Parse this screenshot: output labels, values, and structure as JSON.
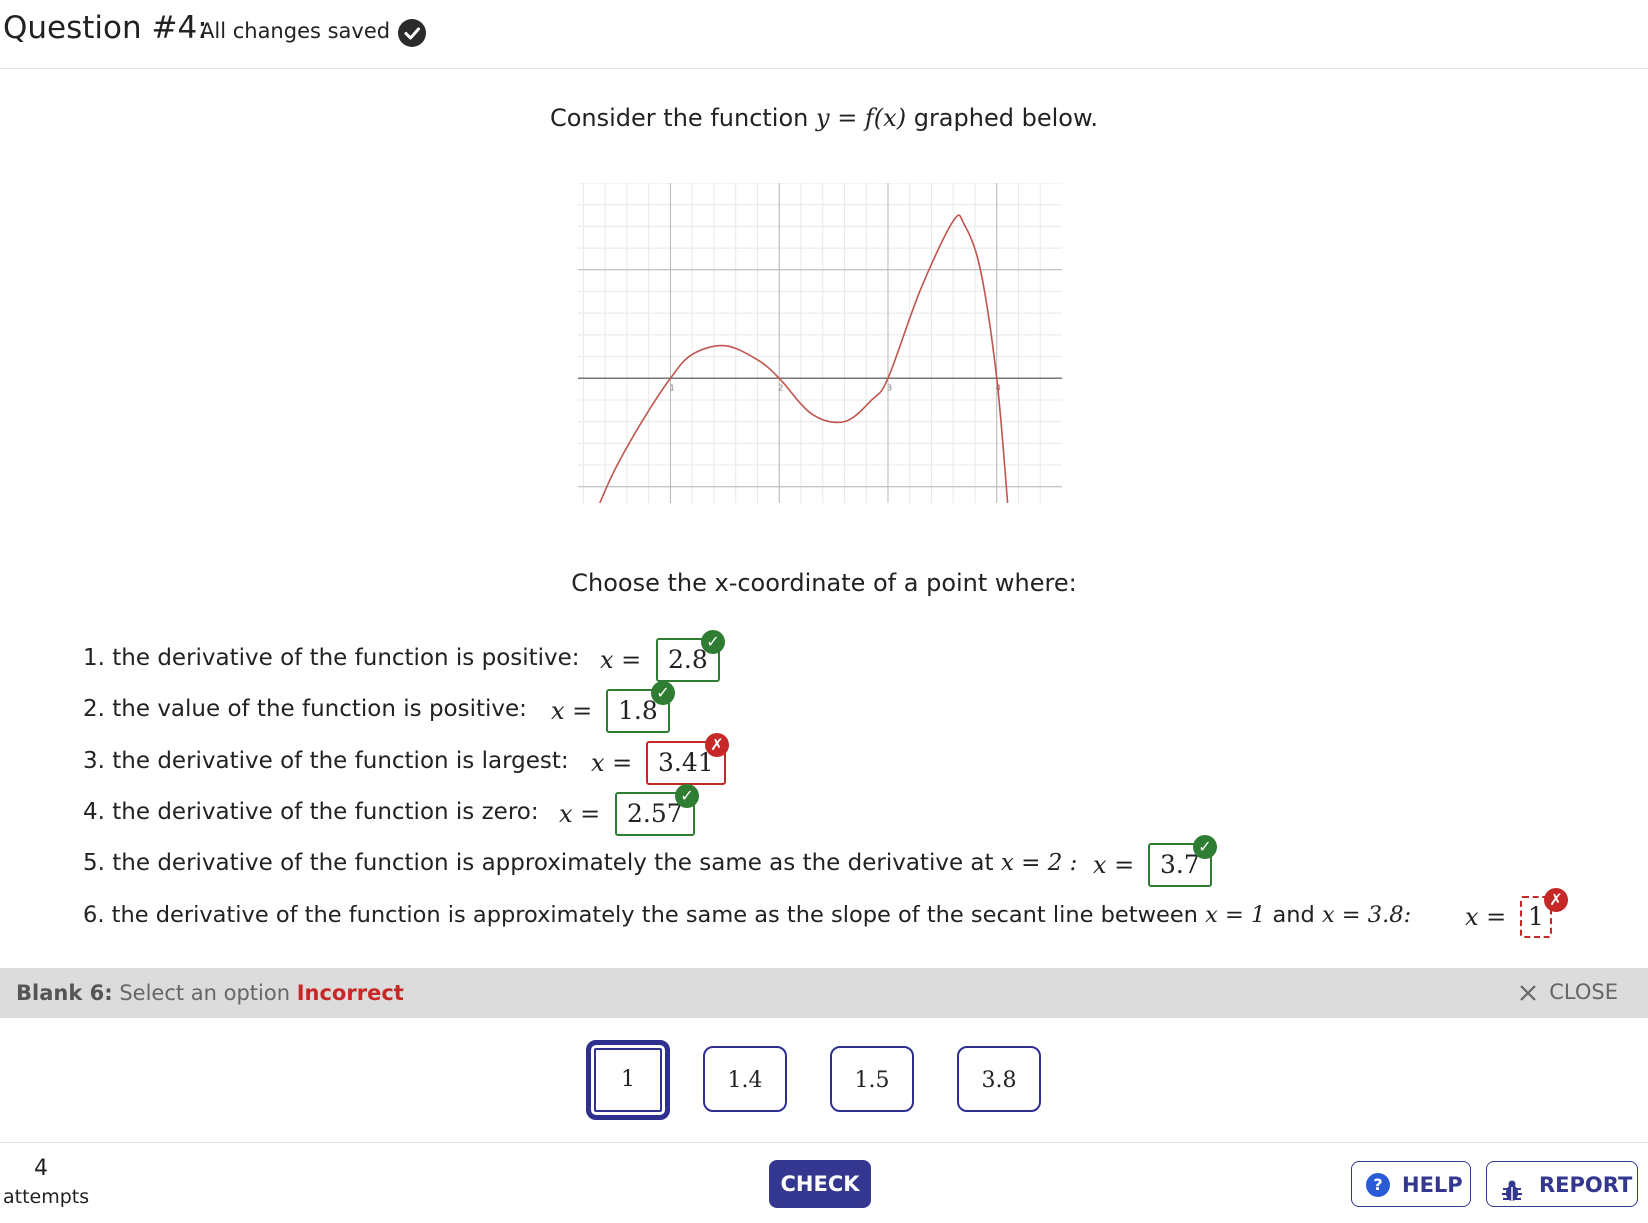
{
  "header": {
    "title": "Question #4:",
    "status": "All changes saved",
    "status_icon": "check-circle-icon"
  },
  "prompt": {
    "intro_before": "Consider the function ",
    "intro_math": "y = f(x)",
    "intro_after": " graphed below.",
    "choose": "Choose the x-coordinate of a point where:"
  },
  "chart_data": {
    "type": "line",
    "title": "",
    "xlabel": "",
    "ylabel": "",
    "x_ticks": [
      "1",
      "2",
      "3",
      "4"
    ],
    "xlim": [
      0.15,
      4.6
    ],
    "ylim": [
      -1.15,
      1.8
    ],
    "grid": true,
    "series": [
      {
        "color": "#c0554d",
        "x": [
          0.35,
          0.5,
          0.75,
          1.0,
          1.2,
          1.5,
          1.8,
          2.0,
          2.3,
          2.6,
          2.85,
          3.0,
          3.3,
          3.6,
          3.7,
          3.85,
          4.0,
          4.1
        ],
        "y": [
          -1.15,
          -0.82,
          -0.38,
          0.0,
          0.22,
          0.3,
          0.17,
          0.0,
          -0.33,
          -0.4,
          -0.2,
          0.0,
          0.82,
          1.45,
          1.42,
          1.0,
          0.0,
          -1.15
        ]
      }
    ]
  },
  "questions": [
    {
      "num": "1.",
      "text": "the derivative of the function is positive:",
      "eq": "x =",
      "answer": "2.8",
      "status": "correct"
    },
    {
      "num": "2.",
      "text": "the value of the function is positive:",
      "eq": "x =",
      "answer": "1.8",
      "status": "correct"
    },
    {
      "num": "3.",
      "text": "the derivative of the function is largest:",
      "eq": "x =",
      "answer": "3.41",
      "status": "incorrect"
    },
    {
      "num": "4.",
      "text": "the derivative of the function is zero:",
      "eq": "x =",
      "answer": "2.57",
      "status": "correct"
    },
    {
      "num": "5.",
      "text": "the derivative of the function is approximately the same as the derivative at",
      "math": "x = 2 :",
      "eq": "x =",
      "answer": "3.7",
      "status": "correct"
    },
    {
      "num": "6.",
      "text": "the derivative of the function is approximately the same as the slope of the secant line between",
      "math1": "x = 1",
      "and": "and",
      "math2": "x = 3.8:",
      "eq": "x =",
      "answer": "1",
      "status": "incorrect"
    }
  ],
  "blank_bar": {
    "label": "Blank 6:",
    "instruction": "Select an option",
    "result": "Incorrect",
    "close": "CLOSE",
    "close_icon": "close-icon"
  },
  "options": [
    "1",
    "1.4",
    "1.5",
    "3.8"
  ],
  "selected_option": "1",
  "footer": {
    "attempts_count": "4",
    "attempts_label": "attempts",
    "check": "CHECK",
    "help": "HELP",
    "help_icon": "question-circle-icon",
    "report": "REPORT",
    "report_icon": "bug-icon"
  },
  "colors": {
    "accent": "#34378f",
    "correct": "#2e7d32",
    "incorrect": "#c62828",
    "curve": "#c0554d"
  }
}
